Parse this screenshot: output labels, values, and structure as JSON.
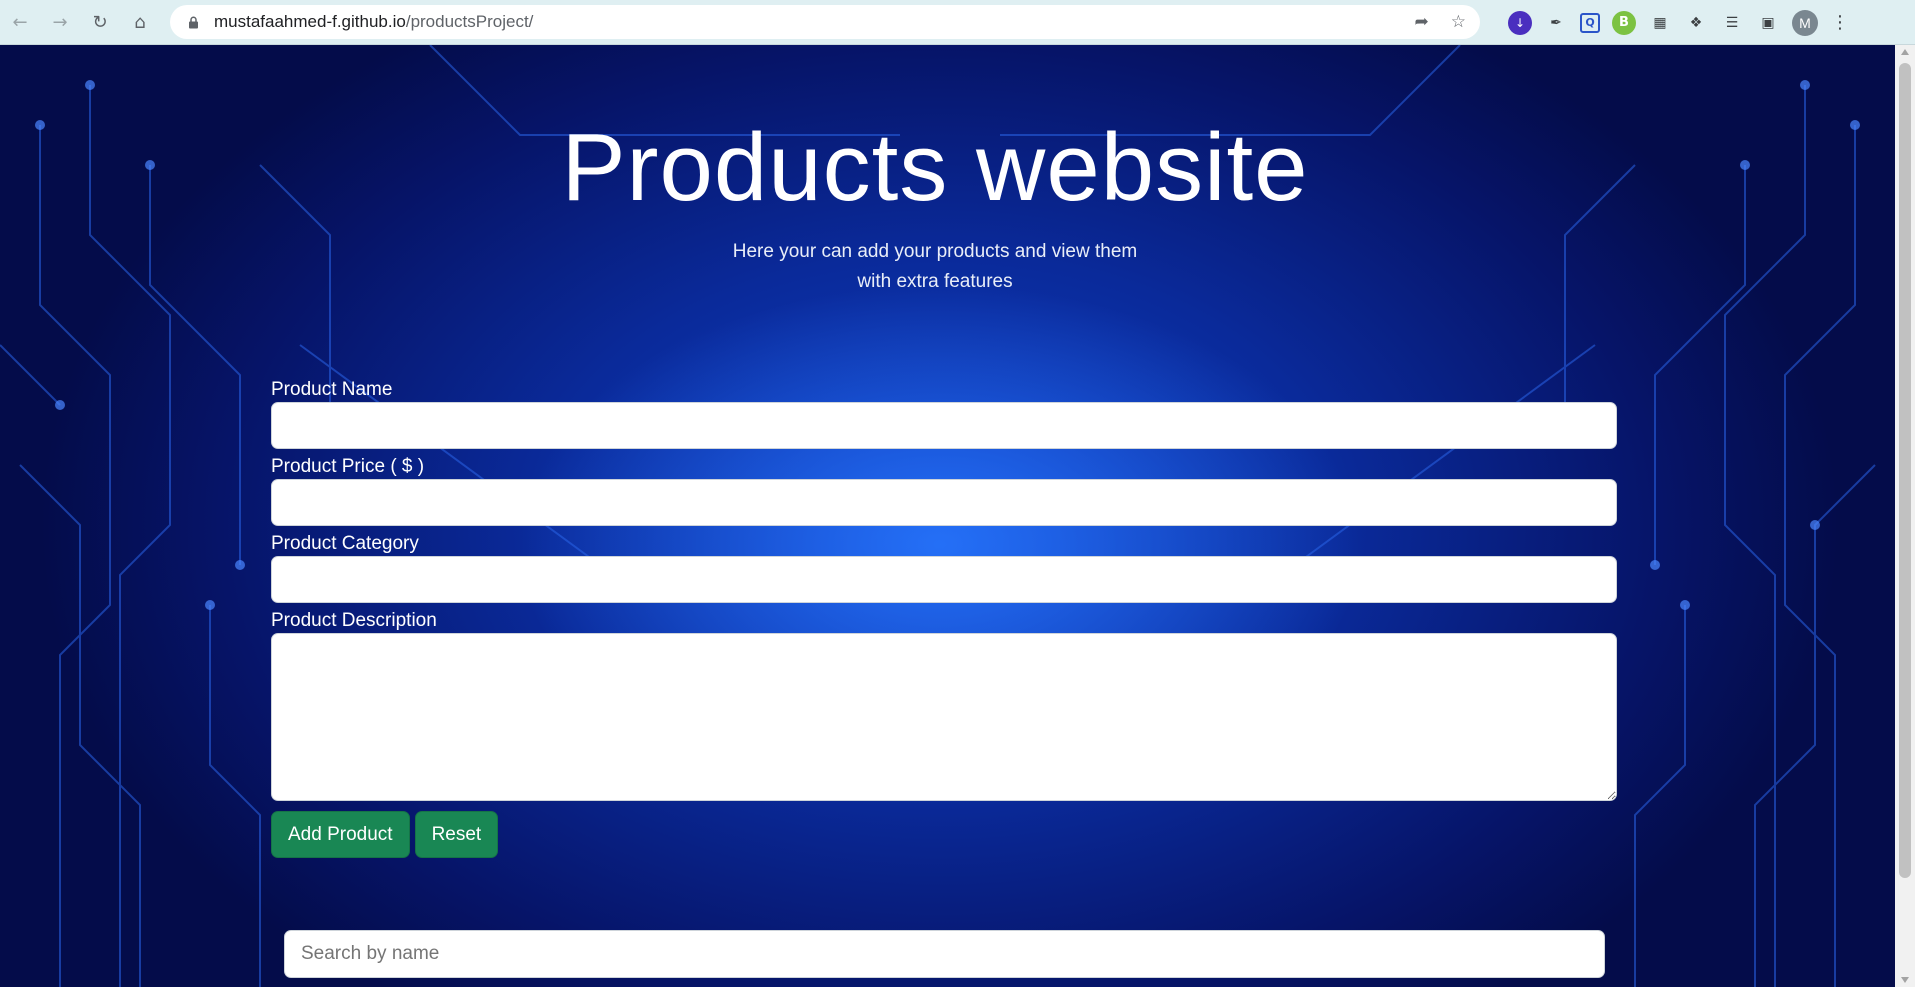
{
  "browser": {
    "url_host": "mustafaahmed-f.github.io",
    "url_path": "/productsProject/",
    "profile_initial": "M"
  },
  "page": {
    "title": "Products website",
    "subtitle_line1": "Here your can add your products and view them",
    "subtitle_line2": "with extra features"
  },
  "form": {
    "name_label": "Product Name",
    "name_value": "",
    "price_label": "Product Price ( $ )",
    "price_value": "",
    "category_label": "Product Category",
    "category_value": "",
    "description_label": "Product Description",
    "description_value": "",
    "add_button": "Add Product",
    "reset_button": "Reset"
  },
  "search": {
    "placeholder": "Search by name"
  },
  "colors": {
    "button": "#198754",
    "background": "#0a2a9a",
    "chrome": "#dfeff2"
  }
}
